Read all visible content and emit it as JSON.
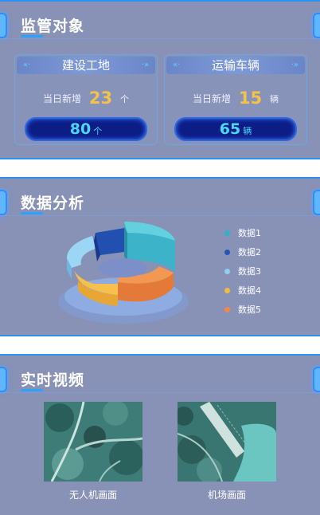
{
  "supervision": {
    "title": "监管对象",
    "cards": [
      {
        "title": "建设工地",
        "today_label": "当日新增",
        "today_value": "23",
        "today_unit": "个",
        "total": "80",
        "total_unit": "个"
      },
      {
        "title": "运输车辆",
        "today_label": "当日新增",
        "today_value": "15",
        "today_unit": "辆",
        "total": "65",
        "total_unit": "辆"
      }
    ]
  },
  "analysis": {
    "title": "数据分析",
    "legend": [
      {
        "label": "数据1",
        "color": "#2fb1c9"
      },
      {
        "label": "数据2",
        "color": "#2456b8"
      },
      {
        "label": "数据3",
        "color": "#8fd0f2"
      },
      {
        "label": "数据4",
        "color": "#f4b93f"
      },
      {
        "label": "数据5",
        "color": "#f0884a"
      }
    ]
  },
  "video": {
    "title": "实时视频",
    "tiles": [
      {
        "label": "无人机画面"
      },
      {
        "label": "机场画面"
      }
    ]
  },
  "colors": {
    "panel_bg": "#8891b6",
    "accent": "#2f8ff0",
    "value_gold": "#f4c24b",
    "pill_text": "#49d9ff"
  }
}
